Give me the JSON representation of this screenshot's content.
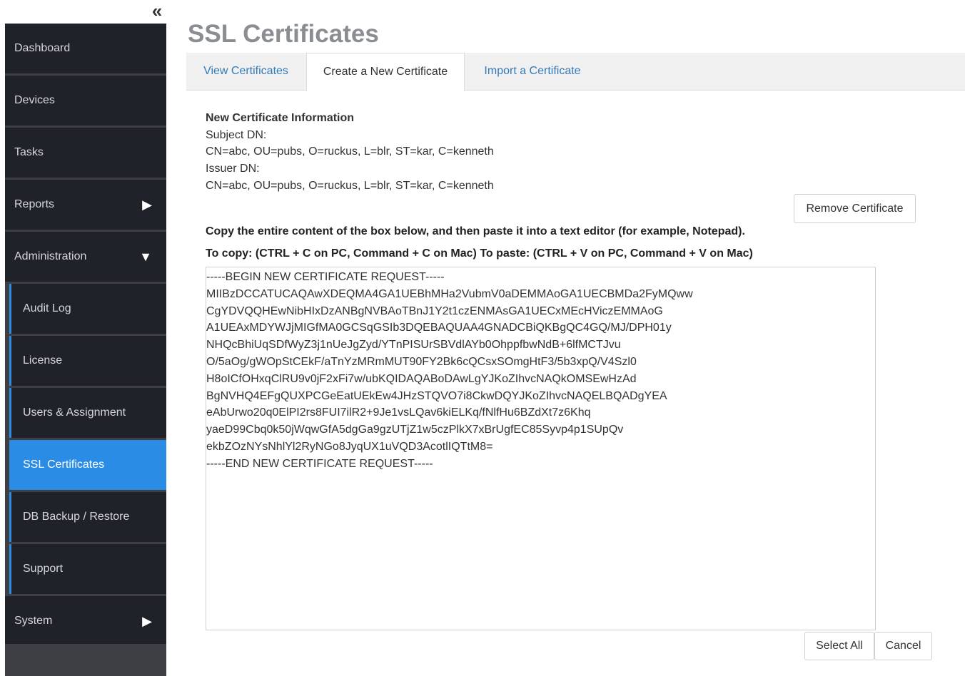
{
  "sidebar": {
    "collapse_icon": "«",
    "items": [
      {
        "label": "Dashboard"
      },
      {
        "label": "Devices"
      },
      {
        "label": "Tasks"
      },
      {
        "label": "Reports",
        "arrow": "▶"
      },
      {
        "label": "Administration",
        "arrow": "▼"
      }
    ],
    "admin_sub_items": [
      {
        "label": "Audit Log"
      },
      {
        "label": "License"
      },
      {
        "label": "Users & Assignment"
      },
      {
        "label": "SSL Certificates",
        "active": true
      },
      {
        "label": "DB Backup / Restore"
      },
      {
        "label": "Support"
      }
    ],
    "system": {
      "label": "System",
      "arrow": "▶"
    }
  },
  "page": {
    "title": "SSL Certificates",
    "tabs": [
      {
        "label": "View Certificates",
        "active": false
      },
      {
        "label": "Create a New Certificate",
        "active": true
      },
      {
        "label": "Import a Certificate",
        "active": false
      }
    ]
  },
  "certificate_info": {
    "heading": "New Certificate Information",
    "subject_label": "Subject DN:",
    "subject_value": "CN=abc, OU=pubs, O=ruckus, L=blr, ST=kar, C=kenneth",
    "issuer_label": "Issuer DN:",
    "issuer_value": "CN=abc, OU=pubs, O=ruckus, L=blr, ST=kar, C=kenneth"
  },
  "buttons": {
    "remove": "Remove Certificate",
    "select_all": "Select All",
    "cancel": "Cancel"
  },
  "instructions": {
    "line1": "Copy the entire content of the box below, and then paste it into a text editor (for example, Notepad).",
    "line2": "To copy: (CTRL + C on PC, Command + C on Mac) To paste: (CTRL + V on PC, Command + V on Mac)"
  },
  "csr_text": "-----BEGIN NEW CERTIFICATE REQUEST-----\nMIIBzDCCATUCAQAwXDEQMA4GA1UEBhMHa2VubmV0aDEMMAoGA1UECBMDa2FyMQww\nCgYDVQQHEwNibHIxDzANBgNVBAoTBnJ1Y2t1czENMAsGA1UECxMEcHViczEMMAoG\nA1UEAxMDYWJjMIGfMA0GCSqGSIb3DQEBAQUAA4GNADCBiQKBgQC4GQ/MJ/DPH01y\nNHQcBhiUqSDfWyZ3j1nUeJgZyd/YTnPISUrSBVdlAYb0OhppfbwNdB+6lfMCTJvu\nO/5aOg/gWOpStCEkF/aTnYzMRmMUT90FY2Bk6cQCsxSOmgHtF3/5b3xpQ/V4Szl0\nH8oICfOHxqClRU9v0jF2xFi7w/ubKQIDAQABoDAwLgYJKoZIhvcNAQkOMSEwHzAd\nBgNVHQ4EFgQUXPCGeEatUEkEw4JHzSTQVO7i8CkwDQYJKoZIhvcNAQELBQADgYEA\neAbUrwo20q0ElPI2rs8FUI7ilR2+9Je1vsLQav6kiELKq/fNlfHu6BZdXt7z6Khq\nyaeD99Cbq0k50jWqwGfA5dgGa9gzUTjZ1w5czPlkX7xBrUgfEC85Syvp4p1SUpQv\nekbZOzNYsNhlYl2RyNGo8JyqUX1uVQD3AcotlIQTtM8=\n-----END NEW CERTIFICATE REQUEST-----"
}
